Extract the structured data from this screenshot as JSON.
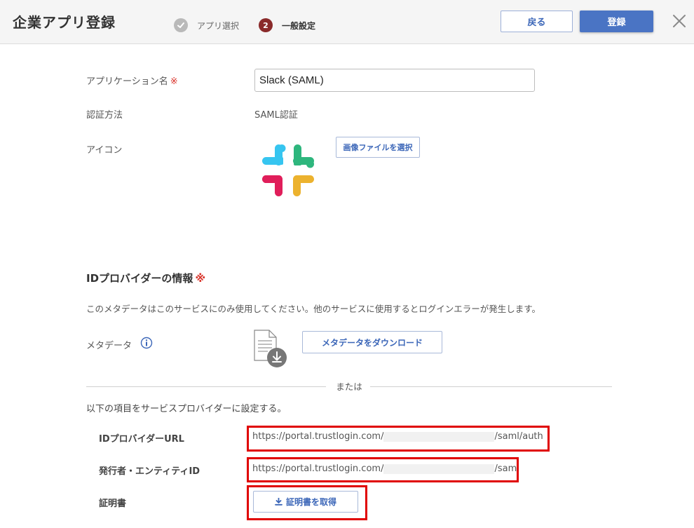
{
  "header": {
    "title": "企業アプリ登録",
    "steps": [
      {
        "number": "✓",
        "label": "アプリ選択"
      },
      {
        "number": "2",
        "label": "一般設定"
      }
    ],
    "back_label": "戻る",
    "register_label": "登録"
  },
  "form": {
    "app_name_label": "アプリケーション名",
    "required_mark": "※",
    "app_name_value": "Slack (SAML)",
    "auth_method_label": "認証方法",
    "auth_method_value": "SAML認証",
    "icon_label": "アイコン",
    "select_image_label": "画像ファイルを選択"
  },
  "idp": {
    "title": "IDプロバイダーの情報",
    "required_mark": "※",
    "note": "このメタデータはこのサービスにのみ使用してください。他のサービスに使用するとログインエラーが発生します。",
    "metadata_label": "メタデータ",
    "download_label": "メタデータをダウンロード",
    "or_label": "または",
    "settings_note": "以下の項目をサービスプロバイダーに設定する。",
    "idp_url_label": "IDプロバイダーURL",
    "idp_url_prefix": "https://portal.trustlogin.com/",
    "idp_url_suffix": "/saml/auth",
    "issuer_label": "発行者・エンティティID",
    "issuer_prefix": "https://portal.trustlogin.com/",
    "issuer_suffix": "/saml",
    "cert_label": "証明書",
    "cert_button_label": "証明書を取得"
  },
  "colors": {
    "primary": "#4a74c4",
    "required": "#d9332a",
    "highlight": "#e00000",
    "step_active": "#8a2a2a"
  }
}
